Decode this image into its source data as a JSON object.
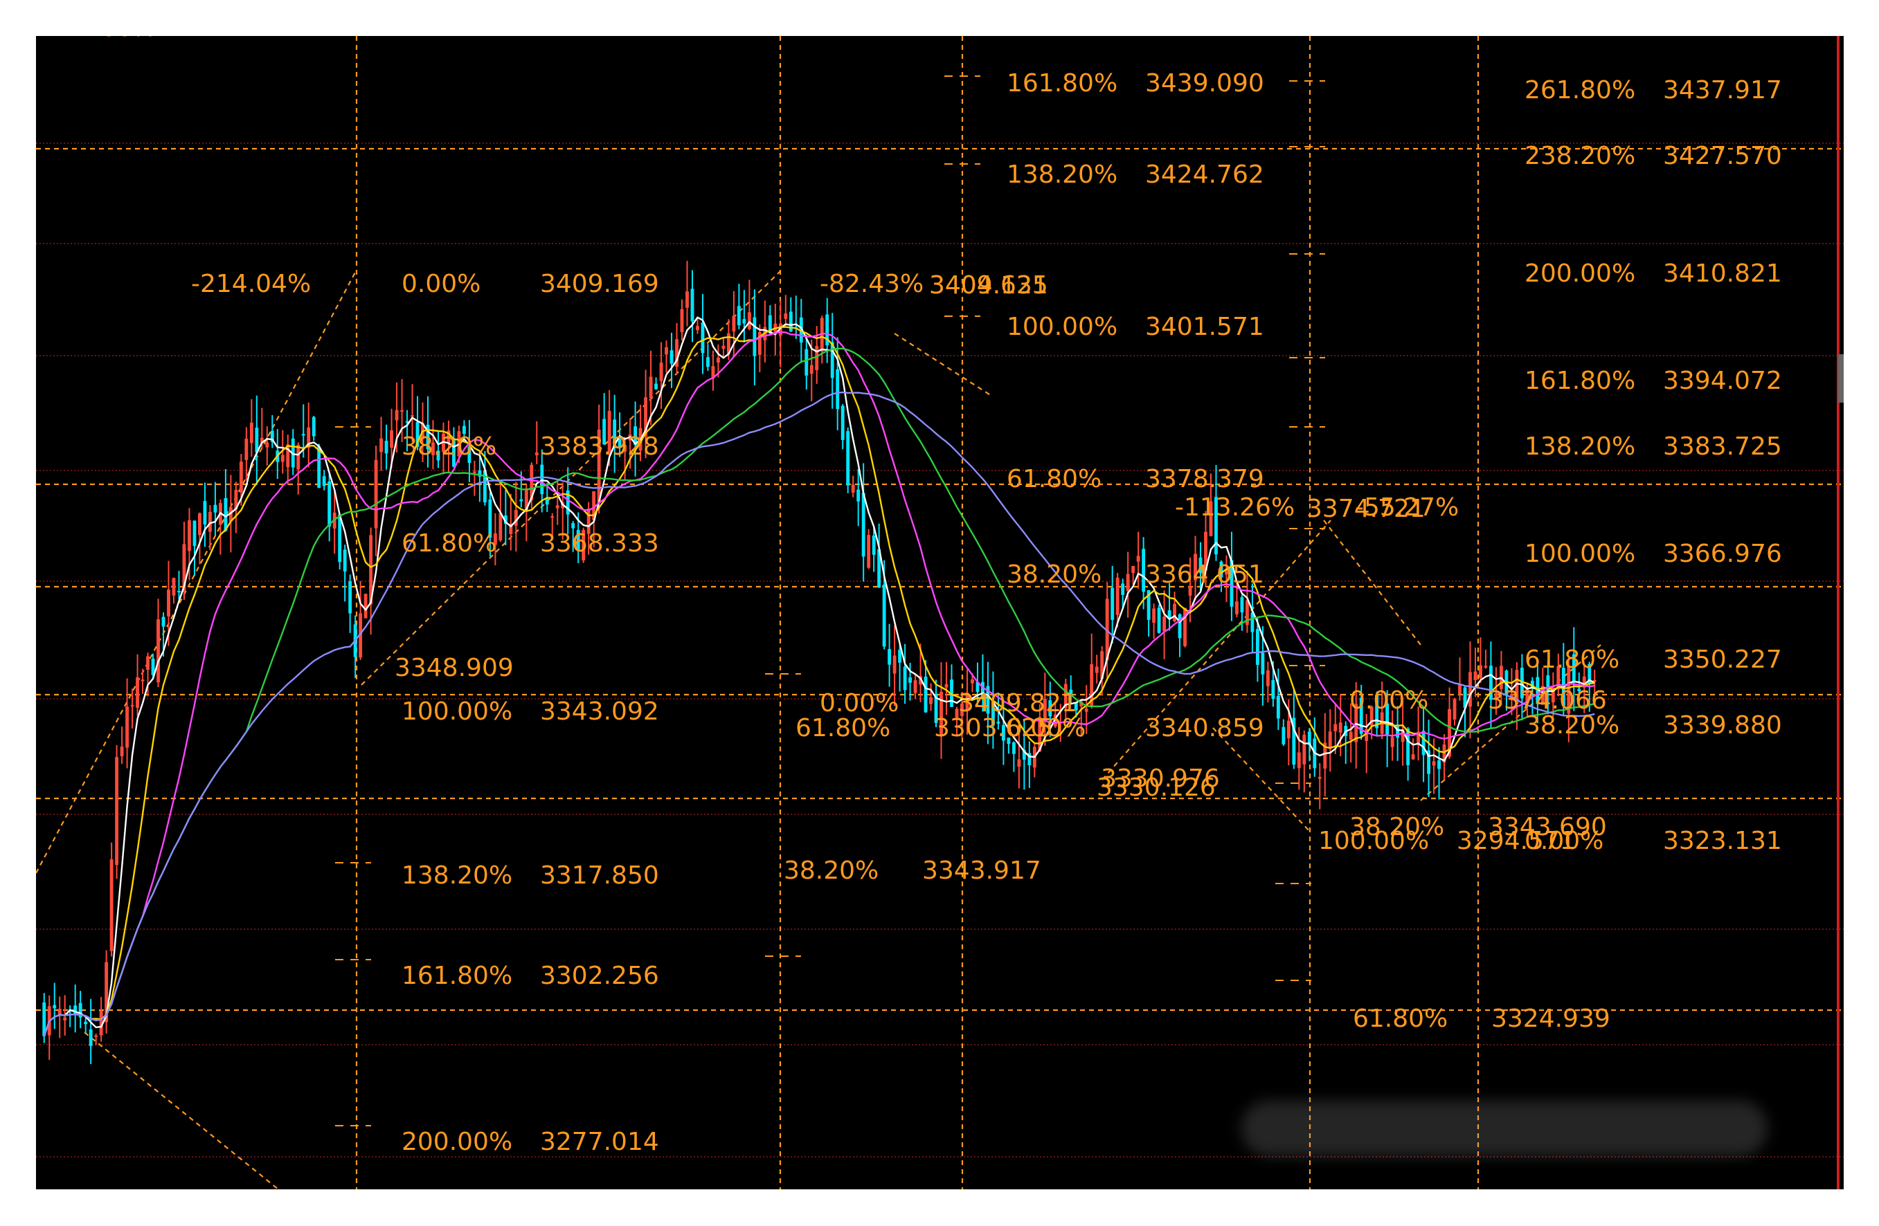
{
  "colors": {
    "background": "#000000",
    "up_candle": "#ff4a3a",
    "down_candle": "#00e5ff",
    "fib_line": "#ff9a1f",
    "fib_text": "#ff9a1f",
    "red_grid": "#8a1c1c",
    "ma5": "#ffffff",
    "ma10": "#ffd400",
    "ma20": "#ff44ff",
    "ma40": "#2ecc40",
    "ma60": "#8c8cff"
  },
  "chart_data": {
    "type": "candlestick",
    "ylim": [
      3268,
      3445
    ],
    "grid": true,
    "candle_count": 300,
    "close_path": [
      [
        0,
        3295
      ],
      [
        10,
        3290
      ],
      [
        12,
        3300
      ],
      [
        14,
        3335
      ],
      [
        22,
        3352
      ],
      [
        28,
        3368
      ],
      [
        33,
        3375
      ],
      [
        36,
        3370
      ],
      [
        40,
        3384
      ],
      [
        45,
        3380
      ],
      [
        52,
        3382
      ],
      [
        57,
        3365
      ],
      [
        60,
        3352
      ],
      [
        62,
        3360
      ],
      [
        64,
        3378
      ],
      [
        69,
        3388
      ],
      [
        75,
        3380
      ],
      [
        80,
        3383
      ],
      [
        85,
        3372
      ],
      [
        90,
        3368
      ],
      [
        95,
        3378
      ],
      [
        100,
        3372
      ],
      [
        103,
        3365
      ],
      [
        107,
        3382
      ],
      [
        110,
        3385
      ],
      [
        114,
        3380
      ],
      [
        118,
        3394
      ],
      [
        121,
        3395
      ],
      [
        124,
        3405
      ],
      [
        128,
        3395
      ],
      [
        132,
        3402
      ],
      [
        138,
        3398
      ],
      [
        143,
        3400
      ],
      [
        147,
        3395
      ],
      [
        150,
        3403
      ],
      [
        153,
        3388
      ],
      [
        156,
        3375
      ],
      [
        160,
        3362
      ],
      [
        163,
        3350
      ],
      [
        168,
        3345
      ],
      [
        173,
        3342
      ],
      [
        178,
        3346
      ],
      [
        183,
        3341
      ],
      [
        188,
        3331
      ],
      [
        193,
        3344
      ],
      [
        200,
        3342
      ],
      [
        206,
        3358
      ],
      [
        211,
        3362
      ],
      [
        216,
        3354
      ],
      [
        220,
        3356
      ],
      [
        225,
        3372
      ],
      [
        228,
        3362
      ],
      [
        231,
        3358
      ],
      [
        236,
        3345
      ],
      [
        240,
        3337
      ],
      [
        245,
        3333
      ],
      [
        250,
        3339
      ],
      [
        255,
        3342
      ],
      [
        260,
        3339
      ],
      [
        265,
        3335
      ],
      [
        268,
        3332
      ],
      [
        271,
        3342
      ],
      [
        273,
        3345
      ]
    ],
    "fib_labels": [
      {
        "pct": "161.80%",
        "value": "3439.090"
      },
      {
        "pct": "138.20%",
        "value": "3424.762"
      },
      {
        "pct": "100.00%",
        "value": "3401.571"
      },
      {
        "pct": "61.80%",
        "value": "3378.379"
      },
      {
        "pct": "38.20%",
        "value": "3364.051"
      },
      {
        "pct": "0.00%",
        "value": "3340.859"
      },
      {
        "pct": "261.80%",
        "value": "3437.917"
      },
      {
        "pct": "238.20%",
        "value": "3427.570"
      },
      {
        "pct": "200.00%",
        "value": "3410.821"
      },
      {
        "pct": "161.80%",
        "value": "3394.072"
      },
      {
        "pct": "138.20%",
        "value": "3383.725"
      },
      {
        "pct": "100.00%",
        "value": "3366.976"
      },
      {
        "pct": "61.80%",
        "value": "3350.227"
      },
      {
        "pct": "38.20%",
        "value": "3339.880"
      },
      {
        "pct": "0.00%",
        "value": "3323.131"
      },
      {
        "pct": "-214.04%",
        "value": ""
      },
      {
        "pct": "0.00%",
        "value": "3409.169"
      },
      {
        "pct": "38.20%",
        "value": "3383.928"
      },
      {
        "pct": "61.80%",
        "value": "3368.333"
      },
      {
        "pct": "100.00%",
        "value": "3343.092"
      },
      {
        "pct": "138.20%",
        "value": "3317.850"
      },
      {
        "pct": "161.80%",
        "value": "3302.256"
      },
      {
        "pct": "200.00%",
        "value": "3277.014"
      },
      {
        "pct": "-82.43%",
        "value": ""
      },
      {
        "pct": "0.00%",
        "value": "3409.821"
      },
      {
        "pct": "38.20%",
        "value": "3343.917"
      },
      {
        "pct": "61.80%",
        "value": "3303.625"
      },
      {
        "pct": "-113.26%",
        "value": ""
      },
      {
        "pct": "-55.27%",
        "value": ""
      },
      {
        "pct": "0.00%",
        "value": "3374.066"
      },
      {
        "pct": "38.20%",
        "value": "3343.690"
      },
      {
        "pct": "61.80%",
        "value": "3324.939"
      },
      {
        "pct": "100.00%",
        "value": "3294.571"
      },
      {
        "pct": "-117.66%",
        "value": ""
      }
    ],
    "price_labels": [
      "3348.909",
      "3330.976",
      "3330.126",
      "3374.721",
      "3409.135",
      "3404.621"
    ]
  }
}
